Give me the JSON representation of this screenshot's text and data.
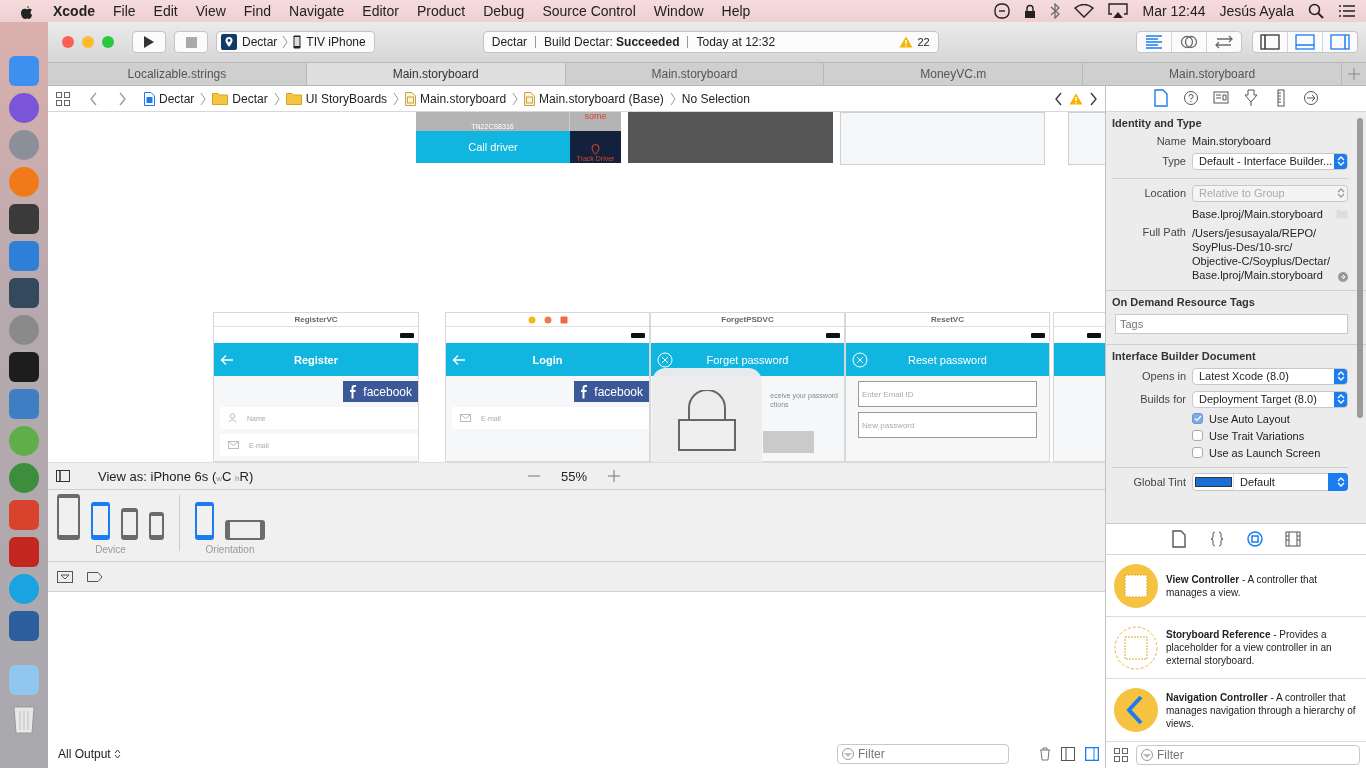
{
  "menu_bar": {
    "items": [
      {
        "label": "Xcode",
        "kind": "app"
      },
      {
        "label": "File",
        "kind": "menu"
      },
      {
        "label": "Edit",
        "kind": "menu"
      },
      {
        "label": "View",
        "kind": "menu"
      },
      {
        "label": "Find",
        "kind": "menu"
      },
      {
        "label": "Navigate",
        "kind": "menu"
      },
      {
        "label": "Editor",
        "kind": "menu"
      },
      {
        "label": "Product",
        "kind": "menu"
      },
      {
        "label": "Debug",
        "kind": "menu"
      },
      {
        "label": "Source Control",
        "kind": "menu"
      },
      {
        "label": "Window",
        "kind": "menu"
      },
      {
        "label": "Help",
        "kind": "menu"
      }
    ],
    "clock": "Mar 12:44",
    "user": "Jesús Ayala"
  },
  "toolbar": {
    "scheme": {
      "project": "Dectar",
      "device": "TIV iPhone"
    },
    "activity": {
      "project": "Dectar",
      "status": "Build Dectar: **Succeeded**",
      "time": "Today at 12:32",
      "warnings": "22"
    },
    "editor_modes": [
      {
        "kind": "standard",
        "selected": true
      },
      {
        "kind": "assistant",
        "selected": false
      },
      {
        "kind": "version",
        "selected": false
      }
    ],
    "panels": [
      {
        "kind": "navigator",
        "on": false
      },
      {
        "kind": "debug",
        "on": true
      },
      {
        "kind": "utilities",
        "on": true
      }
    ]
  },
  "tabs": [
    {
      "label": "Localizable.strings",
      "selected": false
    },
    {
      "label": "Main.storyboard",
      "selected": true
    },
    {
      "label": "Main.storyboard",
      "selected": false
    },
    {
      "label": "MoneyVC.m",
      "selected": false
    },
    {
      "label": "Main.storyboard",
      "selected": false
    }
  ],
  "jump_bar": {
    "items": [
      {
        "label": "Dectar",
        "kind": "project"
      },
      {
        "label": "Dectar",
        "kind": "folder"
      },
      {
        "label": "UI StoryBoards",
        "kind": "folder"
      },
      {
        "label": "Main.storyboard",
        "kind": "storyboard"
      },
      {
        "label": "Main.storyboard (Base)",
        "kind": "storyboard"
      },
      {
        "label": "No Selection",
        "kind": "text"
      }
    ]
  },
  "canvas": {
    "scenes": [
      {
        "kind": "trip",
        "plate": "TN22CS8316",
        "status": "some",
        "call_button": "Call driver",
        "track_button": "Track Driver"
      },
      {
        "kind": "dark"
      },
      {
        "kind": "blank"
      },
      {
        "kind": "blank"
      },
      {
        "kind": "form",
        "title": "RegisterVC",
        "nav": {
          "kind": "back",
          "title": "Register"
        },
        "facebook": "facebook",
        "fields": [
          {
            "placeholder": "Name",
            "kind": "person"
          },
          {
            "placeholder": "E-mail",
            "kind": "mail"
          }
        ]
      },
      {
        "kind": "form",
        "title_icons": true,
        "nav": {
          "kind": "back",
          "title": "Login"
        },
        "facebook": "facebook",
        "fields": [
          {
            "placeholder": "E-mail",
            "kind": "mail"
          }
        ]
      },
      {
        "kind": "form",
        "title": "ForgetPSDVC",
        "nav": {
          "kind": "close",
          "title": "Forget password"
        },
        "note": [
          "eceive your password",
          "ctions"
        ]
      },
      {
        "kind": "form",
        "title": "ResetVC",
        "nav": {
          "kind": "close",
          "title": "Reset password"
        },
        "fields": [
          {
            "placeholder": "Enter Email ID",
            "kind": "outlined"
          },
          {
            "placeholder": "New password",
            "kind": "outlined"
          }
        ]
      },
      {
        "kind": "form"
      }
    ]
  },
  "view_as": {
    "label": "View as: iPhone 6s ($_{w}$C $_{h}$R)",
    "zoom": "55%"
  },
  "devices": {
    "items": [
      {
        "kind": "large",
        "selected": false
      },
      {
        "kind": "medium",
        "selected": true
      },
      {
        "kind": "small",
        "selected": false
      },
      {
        "kind": "smallest",
        "selected": false
      }
    ],
    "label": "Device",
    "orientations": [
      {
        "kind": "portrait",
        "selected": true
      },
      {
        "kind": "landscape",
        "selected": false
      }
    ],
    "orientation_label": "Orientation"
  },
  "console": {
    "output": "All Output",
    "filter_placeholder": "Filter",
    "panes": [
      {
        "kind": "variables",
        "on": false
      },
      {
        "kind": "console",
        "on": true
      }
    ]
  },
  "inspector": {
    "tabs": [
      {
        "kind": "file",
        "selected": true
      },
      {
        "kind": "help",
        "selected": false
      },
      {
        "kind": "identity",
        "selected": false
      },
      {
        "kind": "attributes",
        "selected": false
      },
      {
        "kind": "size",
        "selected": false
      },
      {
        "kind": "connections",
        "selected": false
      }
    ],
    "identity": {
      "title": "Identity and Type",
      "name_label": "Name",
      "name": "Main.storyboard",
      "type_label": "Type",
      "type": "Default - Interface Builder...",
      "location_label": "Location",
      "location": "Relative to Group",
      "location_path": "Base.lproj/Main.storyboard",
      "full_path_label": "Full Path",
      "full_path": [
        "/Users/jesusayala/REPO/",
        "SoyPlus-Des/10-src/",
        "Objective-C/Soyplus/Dectar/",
        "Base.lproj/Main.storyboard"
      ]
    },
    "tags": {
      "title": "On Demand Resource Tags",
      "placeholder": "Tags"
    },
    "document": {
      "title": "Interface Builder Document",
      "opens_in_label": "Opens in",
      "opens_in": "Latest Xcode (8.0)",
      "builds_for_label": "Builds for",
      "builds_for": "Deployment Target (8.0)",
      "options": [
        {
          "label": "Use Auto Layout",
          "checked": true
        },
        {
          "label": "Use Trait Variations",
          "checked": false
        },
        {
          "label": "Use as Launch Screen",
          "checked": false
        }
      ],
      "tint_label": "Global Tint",
      "tint": "Default"
    }
  },
  "library": {
    "tabs": [
      {
        "kind": "file",
        "selected": false
      },
      {
        "kind": "code",
        "selected": false
      },
      {
        "kind": "object",
        "selected": true
      },
      {
        "kind": "media",
        "selected": false
      }
    ],
    "items": [
      {
        "kind": "view-controller",
        "text": "**View Controller** - A controller that manages a view."
      },
      {
        "kind": "storyboard-reference",
        "text": "**Storyboard Reference** - Provides a placeholder for a view controller in an external storyboard."
      },
      {
        "kind": "navigation-controller",
        "text": "**Navigation Controller** - A controller that manages navigation through a hierarchy of views."
      }
    ],
    "filter_placeholder": "Filter"
  }
}
